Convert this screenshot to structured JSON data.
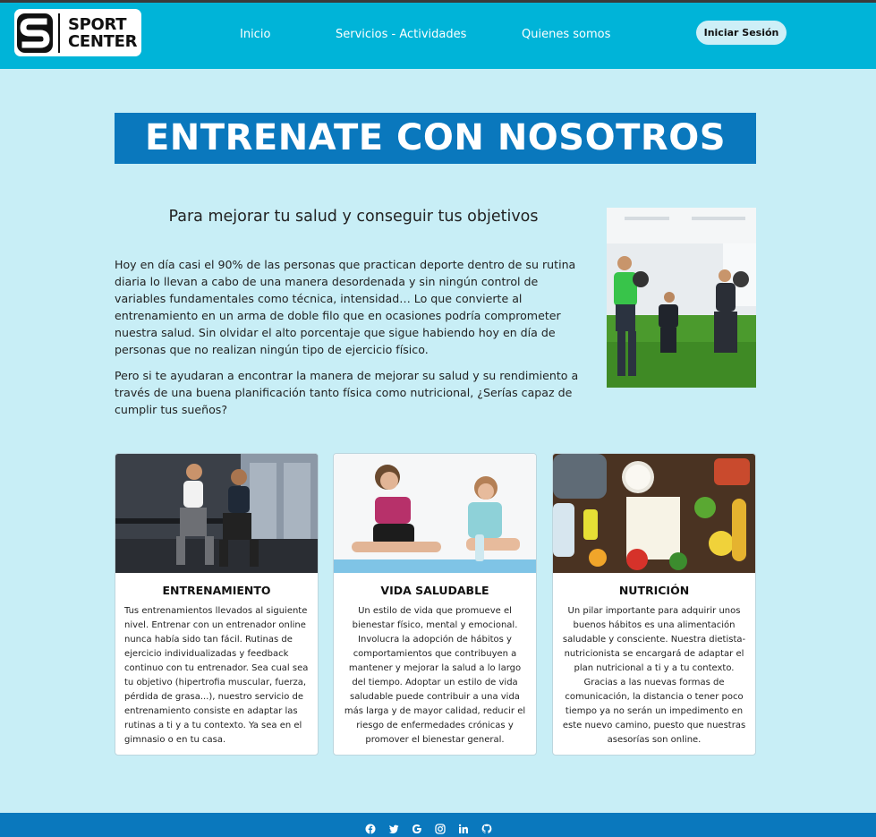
{
  "brand": {
    "line1": "SPORT",
    "line2": "CENTER",
    "mark": "S"
  },
  "nav": {
    "items": [
      {
        "label": "Inicio"
      },
      {
        "label": "Servicios - Actividades"
      },
      {
        "label": "Quienes somos"
      }
    ],
    "login_label": "Iniciar Sesión"
  },
  "hero": {
    "title": "ENTRENATE CON NOSOTROS",
    "subtitle": "Para mejorar tu salud y conseguir tus objetivos",
    "paragraphs": [
      "Hoy en día casi el 90% de las personas que practican deporte dentro de su rutina diaria lo llevan a cabo de una manera desordenada y sin ningún control de variables fundamentales como técnica, intensidad… Lo que convierte al entrenamiento en un arma de doble filo que en ocasiones podría comprometer nuestra salud. Sin olvidar el alto porcentaje que sigue habiendo hoy en día de personas que no realizan ningún tipo de ejercicio físico.",
      "Pero si te ayudaran a encontrar la manera de mejorar su salud y su rendimiento a través de una buena planificación tanto física como nutricional, ¿Serías capaz de cumplir tus sueños?"
    ]
  },
  "cards": [
    {
      "title": "ENTRENAMIENTO",
      "text": "Tus entrenamientos llevados al siguiente nivel. Entrenar con un entrenador online nunca había sido tan fácil. Rutinas de ejercicio individualizadas y feedback continuo con tu entrenador. Sea cual sea tu objetivo (hipertrofia muscular, fuerza, pérdida de grasa...), nuestro servicio de entrenamiento consiste en adaptar las rutinas a ti y a tu contexto. Ya sea en el gimnasio o en tu casa."
    },
    {
      "title": "VIDA SALUDABLE",
      "text": "Un estilo de vida que promueve el bienestar físico, mental y emocional. Involucra la adopción de hábitos y comportamientos que contribuyen a mantener y mejorar la salud a lo largo del tiempo. Adoptar un estilo de vida saludable puede contribuir a una vida más larga y de mayor calidad, reducir el riesgo de enfermedades crónicas y promover el bienestar general."
    },
    {
      "title": "NUTRICIÓN",
      "text": "Un pilar importante para adquirir unos buenos hábitos es una alimentación saludable y consciente. Nuestra dietista-nutricionista se encargará de adaptar el plan nutricional a ti y a tu contexto. Gracias a las nuevas formas de comunicación, la distancia o tener poco tiempo ya no serán un impedimento en este nuevo camino, puesto que nuestras asesorías son online."
    }
  ],
  "footer": {
    "icons": [
      "facebook-icon",
      "twitter-icon",
      "google-icon",
      "instagram-icon",
      "linkedin-icon",
      "github-icon"
    ]
  },
  "colors": {
    "navbar": "#00b4d8",
    "accent": "#0a78bd",
    "page_bg": "#c8eef6"
  }
}
